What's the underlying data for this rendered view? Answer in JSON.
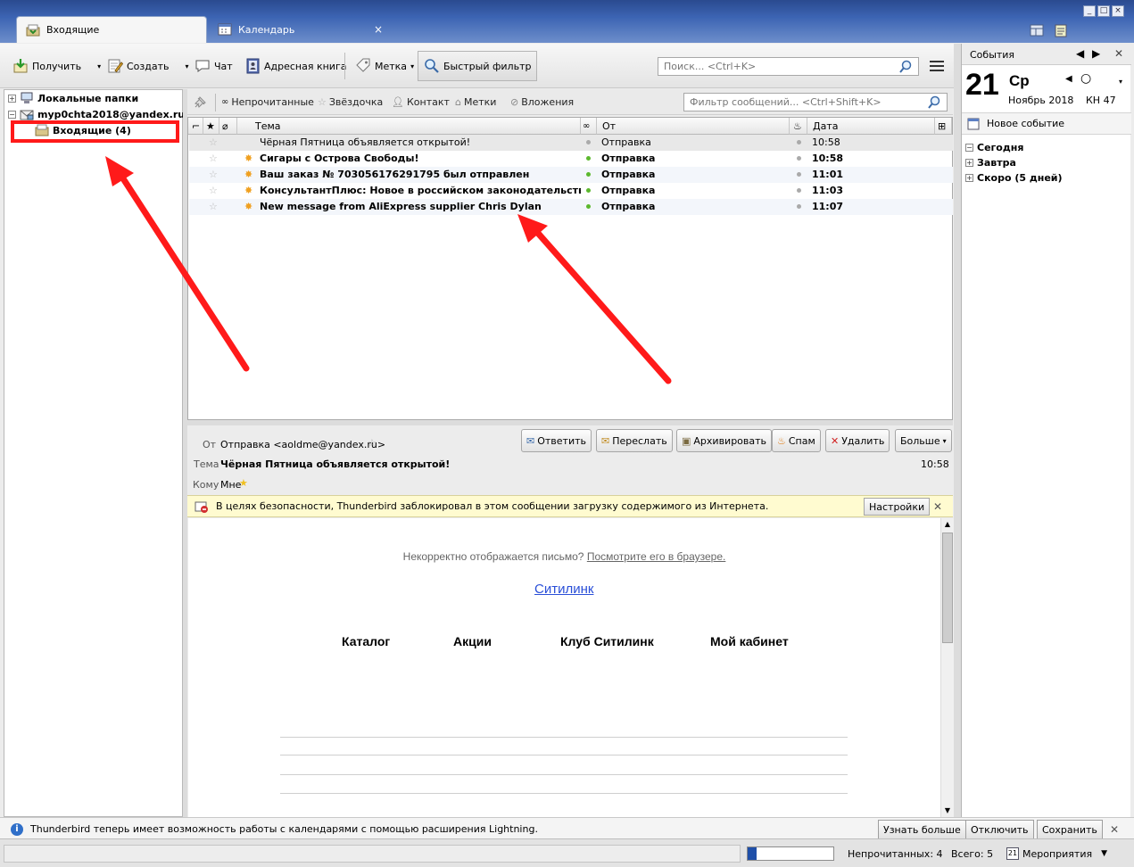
{
  "tabs": [
    {
      "label": "Входящие",
      "close": ""
    },
    {
      "label": "Календарь",
      "close": "×"
    }
  ],
  "window_controls": [
    "_",
    "□",
    "×"
  ],
  "toolbar": {
    "get_label": "Получить",
    "write_label": "Создать",
    "chat_label": "Чат",
    "addressbook_label": "Адресная книга",
    "tag_label": "Метка",
    "quickfilter_label": "Быстрый фильтр",
    "search_placeholder": "Поиск... <Ctrl+K>"
  },
  "folders": {
    "local_label": "Локальные папки",
    "account_label": "myp0chta2018@yandex.ru",
    "inbox_label": "Входящие (4)"
  },
  "quick_filter": {
    "unread": "Непрочитанные",
    "starred": "Звёздочка",
    "contact": "Контакт",
    "tags": "Метки",
    "attachments": "Вложения",
    "placeholder": "Фильтр сообщений... <Ctrl+Shift+K>"
  },
  "columns": {
    "subject": "Тема",
    "from": "От",
    "date": "Дата"
  },
  "messages": [
    {
      "subject": "Чёрная Пятница объявляется открытой!",
      "from": "Отправка",
      "date": "10:58",
      "unread": false
    },
    {
      "subject": "Сигары с Острова Свободы!",
      "from": "Отправка",
      "date": "10:58",
      "unread": true
    },
    {
      "subject": "Ваш заказ № 703056176291795 был отправлен",
      "from": "Отправка",
      "date": "11:01",
      "unread": true
    },
    {
      "subject": "КонсультантПлюс: Новое в российском законодательстве...",
      "from": "Отправка",
      "date": "11:03",
      "unread": true
    },
    {
      "subject": "New message from AliExpress supplier Chris Dylan",
      "from": "Отправка",
      "date": "11:07",
      "unread": true
    }
  ],
  "header": {
    "from_label": "От",
    "from_value": "Отправка <aoldme@yandex.ru>",
    "subject_label": "Тема",
    "subject_value": "Чёрная Пятница объявляется открытой!",
    "to_label": "Кому",
    "to_value": "Мне",
    "time": "10:58"
  },
  "actions": {
    "reply": "Ответить",
    "forward": "Переслать",
    "archive": "Архивировать",
    "spam": "Спам",
    "delete": "Удалить",
    "more": "Больше"
  },
  "notice": {
    "text": "В целях безопасности, Thunderbird заблокировал в этом сообщении загрузку содержимого из Интернета.",
    "settings": "Настройки"
  },
  "email_body": {
    "prefix": "Некорректно отображается письмо?",
    "link": "Посмотрите его в браузере.",
    "brand": "Ситилинк",
    "nav": [
      "Каталог",
      "Акции",
      "Клуб Ситилинк",
      "Мой кабинет"
    ]
  },
  "events": {
    "title": "События",
    "day": "21",
    "weekday": "Ср",
    "month": "Ноябрь 2018",
    "week": "КН 47",
    "new_event": "Новое событие",
    "groups": [
      "Сегодня",
      "Завтра",
      "Скоро (5 дней)"
    ]
  },
  "notification": {
    "text": "Thunderbird теперь имеет возможность работы с календарями с помощью расширения Lightning.",
    "learn_more": "Узнать больше",
    "disable": "Отключить",
    "keep": "Сохранить"
  },
  "status": {
    "unread": "Непрочитанных: 4",
    "total": "Всего: 5",
    "events_menu": "Мероприятия",
    "calendar_day": "21"
  },
  "colors": {
    "accent": "#ff1a1a",
    "unread_dot": "#5cb82e",
    "star_new": "#f0a020"
  }
}
